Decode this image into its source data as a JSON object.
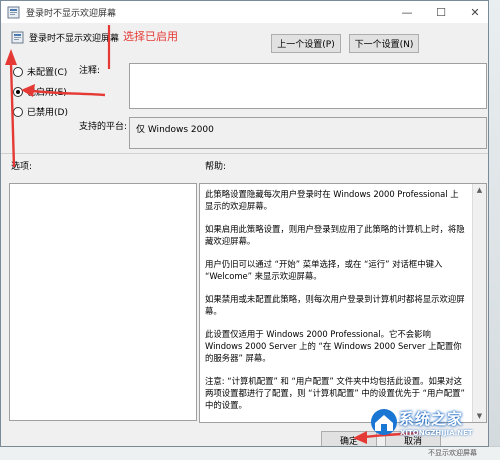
{
  "window": {
    "title": "登录时不显示欢迎屏幕"
  },
  "header": {
    "setting_title": "登录时不显示欢迎屏幕",
    "annotation": "选择已启用",
    "prev_label": "上一个设置(P)",
    "next_label": "下一个设置(N)"
  },
  "radios": [
    {
      "label": "未配置(C)",
      "checked": false
    },
    {
      "label": "已启用(E)",
      "checked": true
    },
    {
      "label": "已禁用(D)",
      "checked": false
    }
  ],
  "comment": {
    "label": "注释:",
    "value": ""
  },
  "platform": {
    "label": "支持的平台:",
    "value": "仅 Windows 2000"
  },
  "options": {
    "label": "选项:"
  },
  "help": {
    "label": "帮助:",
    "paragraphs": [
      "此策略设置隐藏每次用户登录时在 Windows 2000 Professional 上显示的欢迎屏幕。",
      "如果启用此策略设置，则用户登录到应用了此策略的计算机上时，将隐藏欢迎屏幕。",
      "用户仍旧可以通过 “开始” 菜单选择，或在 “运行” 对话框中键入 “Welcome” 来显示欢迎屏幕。",
      "如果禁用或未配置此策略，则每次用户登录到计算机时都将显示欢迎屏幕。",
      "此设置仅适用于 Windows 2000 Professional。它不会影响 Windows 2000 Server 上的 “在 Windows 2000 Server 上配置你的服务器” 屏幕。",
      "注意: “计算机配置” 和 “用户配置” 文件夹中均包括此设置。如果对这两项设置都进行了配置，则 “计算机配置” 中的设置优先于 “用户配置” 中的设置。"
    ]
  },
  "footer": {
    "ok_label": "确定",
    "cancel_label": "取消"
  },
  "watermark": {
    "name": "系统之家",
    "url": "XITONGZHIJIA.NET"
  },
  "background_text": "不显示欢迎屏幕",
  "colors": {
    "annotation": "#e53935",
    "focus_border": "#0078d7"
  }
}
